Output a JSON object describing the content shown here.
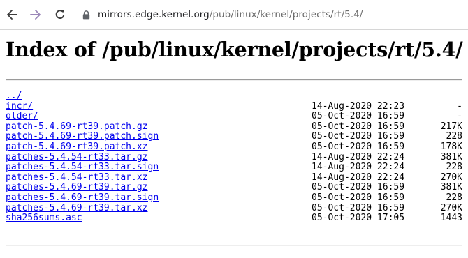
{
  "browser": {
    "url_host": "mirrors.edge.kernel.org",
    "url_path": "/pub/linux/kernel/projects/rt/5.4/"
  },
  "page": {
    "title": "Index of /pub/linux/kernel/projects/rt/5.4/"
  },
  "entries": [
    {
      "name": "../",
      "date": "",
      "size": ""
    },
    {
      "name": "incr/",
      "date": "14-Aug-2020 22:23",
      "size": "-"
    },
    {
      "name": "older/",
      "date": "05-Oct-2020 16:59",
      "size": "-"
    },
    {
      "name": "patch-5.4.69-rt39.patch.gz",
      "date": "05-Oct-2020 16:59",
      "size": "217K"
    },
    {
      "name": "patch-5.4.69-rt39.patch.sign",
      "date": "05-Oct-2020 16:59",
      "size": "228"
    },
    {
      "name": "patch-5.4.69-rt39.patch.xz",
      "date": "05-Oct-2020 16:59",
      "size": "178K"
    },
    {
      "name": "patches-5.4.54-rt33.tar.gz",
      "date": "14-Aug-2020 22:24",
      "size": "381K"
    },
    {
      "name": "patches-5.4.54-rt33.tar.sign",
      "date": "14-Aug-2020 22:24",
      "size": "228"
    },
    {
      "name": "patches-5.4.54-rt33.tar.xz",
      "date": "14-Aug-2020 22:24",
      "size": "270K"
    },
    {
      "name": "patches-5.4.69-rt39.tar.gz",
      "date": "05-Oct-2020 16:59",
      "size": "381K"
    },
    {
      "name": "patches-5.4.69-rt39.tar.sign",
      "date": "05-Oct-2020 16:59",
      "size": "228"
    },
    {
      "name": "patches-5.4.69-rt39.tar.xz",
      "date": "05-Oct-2020 16:59",
      "size": "270K"
    },
    {
      "name": "sha256sums.asc",
      "date": "05-Oct-2020 17:05",
      "size": "1443"
    }
  ]
}
